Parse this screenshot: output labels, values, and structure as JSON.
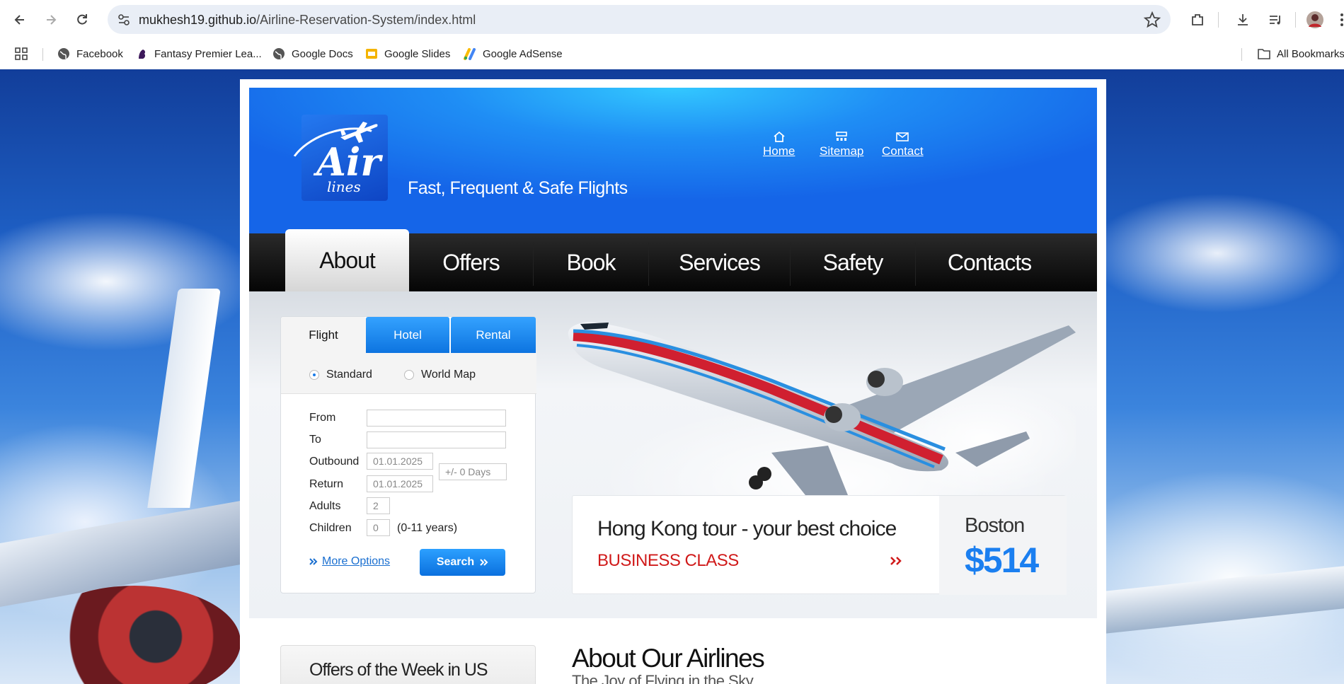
{
  "browser": {
    "url_domain": "mukhesh19.github.io",
    "url_path": "/Airline-Reservation-System/index.html",
    "bookmarks": [
      "Facebook",
      "Fantasy Premier Lea...",
      "Google Docs",
      "Google Slides",
      "Google AdSense"
    ],
    "all_bookmarks": "All Bookmarks"
  },
  "header": {
    "logo_air": "Air",
    "logo_lines": "lines",
    "tagline": "Fast, Frequent & Safe Flights",
    "links": [
      "Home",
      "Sitemap",
      "Contact"
    ]
  },
  "nav": {
    "items": [
      "About",
      "Offers",
      "Book",
      "Services",
      "Safety",
      "Contacts"
    ],
    "active": "About"
  },
  "booking": {
    "tabs": [
      "Flight",
      "Hotel",
      "Rental"
    ],
    "active_tab": "Flight",
    "radios": [
      "Standard",
      "World Map"
    ],
    "selected_radio": "Standard",
    "labels": {
      "from": "From",
      "to": "To",
      "outbound": "Outbound",
      "return": "Return",
      "adults": "Adults",
      "children": "Children"
    },
    "values": {
      "from": "",
      "to": "",
      "outbound": "01.01.2025",
      "return": "01.01.2025",
      "days": "+/- 0 Days",
      "adults": "2",
      "children": "0",
      "children_note": "(0-11 years)"
    },
    "more_options": "More Options",
    "search": "Search"
  },
  "promo": {
    "title": "Hong Kong tour - your best choice",
    "subtitle": "BUSINESS CLASS",
    "city": "Boston",
    "price": "$514"
  },
  "below": {
    "offers_title": "Offers of the Week in US",
    "about_title": "About Our Airlines",
    "about_sub": "The Joy of Flying in the Sky"
  },
  "colors": {
    "header_blue": "#1f8ef5",
    "tab_blue": "#0d74e0",
    "promo_red": "#d01a1a",
    "price_blue": "#1b7ff0"
  }
}
